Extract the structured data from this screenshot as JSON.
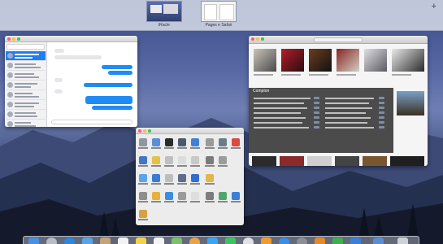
{
  "spaces": [
    {
      "label": "iRacle"
    },
    {
      "label": "Pages e Safari"
    }
  ],
  "add_space_glyph": "+",
  "windows": {
    "messages": {
      "app": "Messages"
    },
    "music": {
      "app": "iTunes",
      "list_title": "Compton"
    },
    "prefs": {
      "app": "System Preferences"
    }
  },
  "icons": [
    "add-space-icon",
    "dock-finder-icon",
    "dock-safari-icon",
    "dock-mail-icon"
  ],
  "colors": {
    "accent_blue": "#1f7df5",
    "close": "#fc605c",
    "minimize": "#fdbc40",
    "zoom": "#34c84a"
  }
}
